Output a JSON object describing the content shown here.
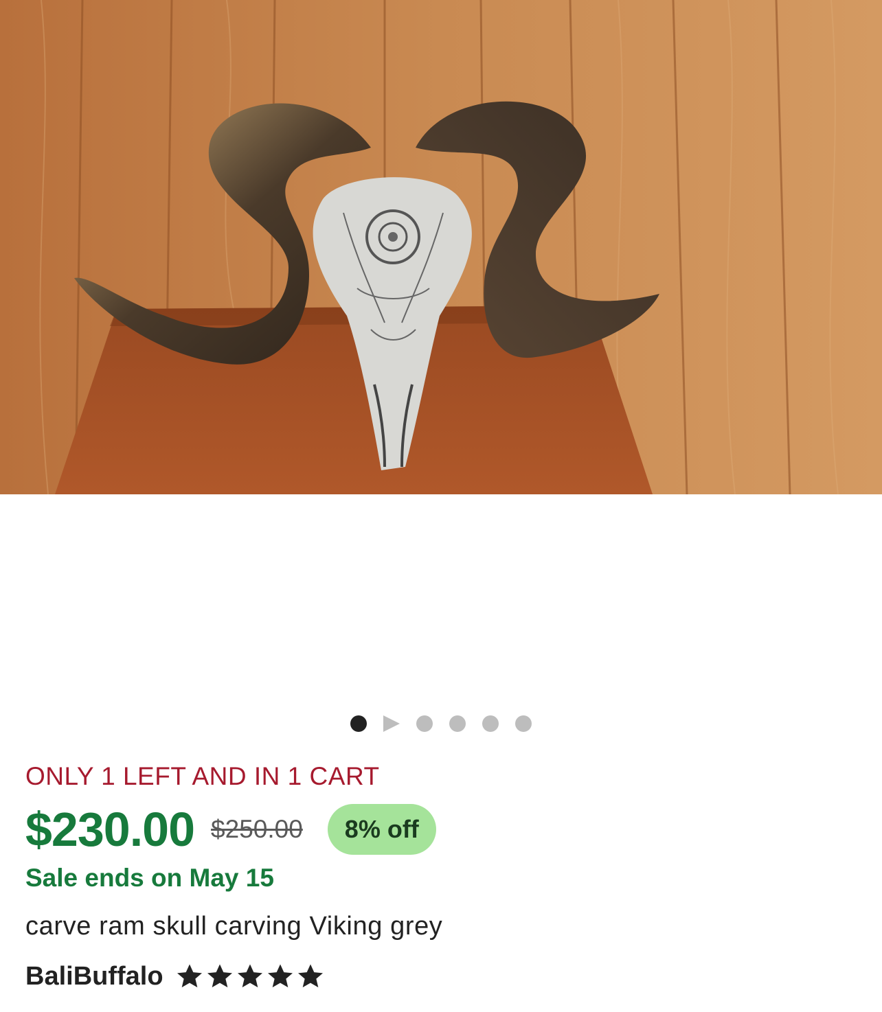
{
  "gallery": {
    "image_alt": "Carved ram skull with curled horns on wooden table",
    "dot_count": 6,
    "active_index": 0
  },
  "listing": {
    "stock_notice": "ONLY 1 LEFT AND IN 1 CART",
    "price": "$230.00",
    "original_price": "$250.00",
    "discount_badge": "8% off",
    "sale_note": "Sale ends on May 15",
    "title": "carve ram skull carving Viking grey"
  },
  "shop": {
    "name": "BaliBuffalo",
    "rating": 5,
    "rating_max": 5
  },
  "colors": {
    "price_green": "#177a3c",
    "stock_red": "#a61a2e",
    "badge_bg": "#a5e39a"
  }
}
